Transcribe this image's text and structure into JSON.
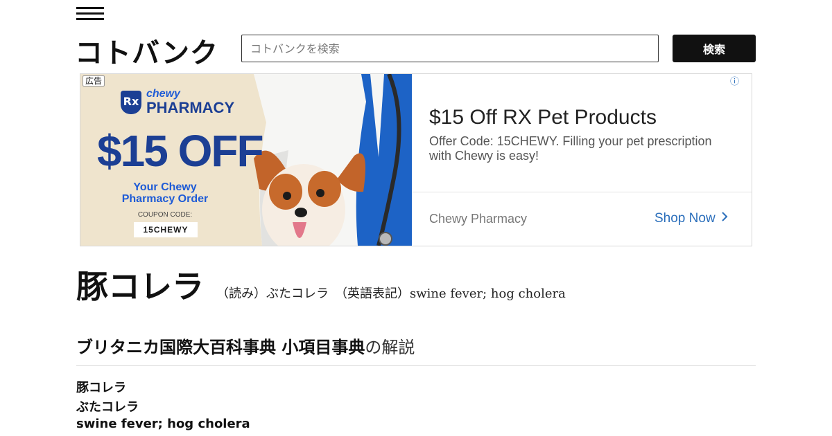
{
  "header": {
    "logo_text": "コトバンク",
    "search": {
      "placeholder": "コトバンクを検索",
      "value": ""
    },
    "search_button_label": "検索"
  },
  "ad": {
    "label": "広告",
    "info_icon": "ⓘ",
    "image": {
      "brand_top": "chewy",
      "brand_bottom": "PHARMACY",
      "rx": "Rx",
      "offer": "$15 OFF",
      "sub_line1": "Your Chewy",
      "sub_line2": "Pharmacy Order",
      "coupon_label": "COUPON CODE:",
      "coupon_code": "15CHEWY"
    },
    "headline": "$15 Off RX Pet Products",
    "description": "Offer Code: 15CHEWY. Filling your pet prescription with Chewy is easy!",
    "advertiser": "Chewy Pharmacy",
    "cta": "Shop Now",
    "cta_icon": "chevron-right-icon",
    "colors": {
      "brand_blue": "#1c3f94",
      "sub_blue": "#1e5bd6",
      "link_blue": "#2a6ebb"
    }
  },
  "term": {
    "title": "豚コレラ",
    "reading": "（読み）ぶたコレラ　（英語表記）swine fever; hog cholera"
  },
  "section": {
    "dictionary": "ブリタニカ国際大百科事典 小項目事典",
    "suffix": "の解説"
  },
  "entry": {
    "lines": [
      "豚コレラ",
      "ぶたコレラ",
      "swine fever; hog cholera"
    ]
  }
}
